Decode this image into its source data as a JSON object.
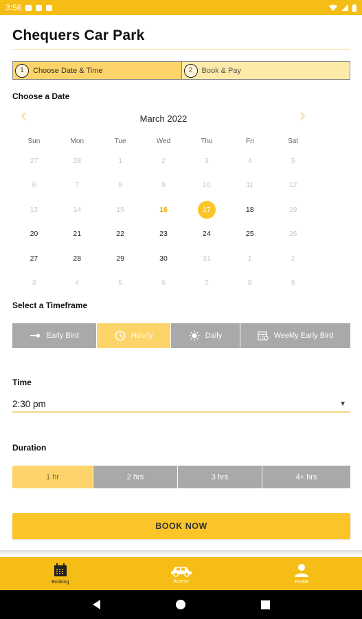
{
  "status_bar": {
    "time": "3:56"
  },
  "page": {
    "title": "Chequers Car Park"
  },
  "steps": [
    {
      "num": "1",
      "label": "Choose Date & Time"
    },
    {
      "num": "2",
      "label": "Book & Pay"
    }
  ],
  "calendar": {
    "section_label": "Choose a Date",
    "month": "March 2022",
    "prev_icon": "chevron-left",
    "next_icon": "chevron-right",
    "days_of_week": [
      "Sun",
      "Mon",
      "Tue",
      "Wed",
      "Thu",
      "Fri",
      "Sat"
    ],
    "weeks": [
      [
        "27",
        "28",
        "1",
        "2",
        "3",
        "4",
        "5"
      ],
      [
        "6",
        "7",
        "8",
        "9",
        "10",
        "11",
        "12"
      ],
      [
        "13",
        "14",
        "15",
        "16",
        "17",
        "18",
        "19"
      ],
      [
        "20",
        "21",
        "22",
        "23",
        "24",
        "25",
        "26"
      ],
      [
        "27",
        "28",
        "29",
        "30",
        "31",
        "1",
        "2"
      ],
      [
        "3",
        "4",
        "5",
        "6",
        "7",
        "8",
        "9"
      ]
    ],
    "today": "16",
    "selected": "17"
  },
  "timeframe": {
    "section_label": "Select a Timeframe",
    "options": [
      {
        "label": "Early Bird",
        "icon": "key-icon"
      },
      {
        "label": "Hourly",
        "icon": "clock-icon"
      },
      {
        "label": "Daily",
        "icon": "sun-icon"
      },
      {
        "label": "Weekly Early Bird",
        "icon": "calendar-week-icon"
      }
    ],
    "selected": "Hourly"
  },
  "time": {
    "label": "Time",
    "value": "2:30 pm"
  },
  "duration": {
    "section_label": "Duration",
    "options": [
      "1 hr",
      "2 hrs",
      "3 hrs",
      "4+ hrs"
    ],
    "selected": "1 hr"
  },
  "book_button": {
    "label": "BOOK NOW"
  },
  "bottom_nav": [
    {
      "label": "Booking",
      "icon": "calendar-icon"
    },
    {
      "label": "Access",
      "icon": "car-icon"
    },
    {
      "label": "Profile",
      "icon": "person-icon"
    }
  ],
  "colors": {
    "accent": "#f6bd16",
    "accent_light": "#fcd46a",
    "inactive": "#a9a9a9"
  }
}
